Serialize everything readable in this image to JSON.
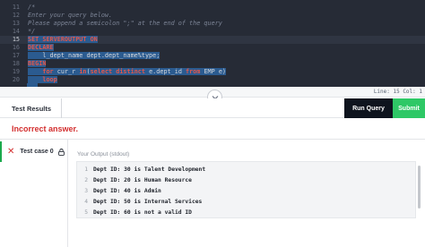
{
  "editor": {
    "lines": [
      {
        "num": "11",
        "parts": [
          {
            "t": "/*",
            "c": "cm"
          }
        ]
      },
      {
        "num": "12",
        "parts": [
          {
            "t": "Enter your query below.",
            "c": "cm"
          }
        ]
      },
      {
        "num": "13",
        "parts": [
          {
            "t": "Please append a semicolon \";\" at the end of the query",
            "c": "cm"
          }
        ]
      },
      {
        "num": "14",
        "parts": [
          {
            "t": "*/",
            "c": "cm"
          }
        ]
      },
      {
        "num": "15",
        "parts": [
          {
            "t": "SET SERVEROUTPUT ON",
            "c": "kw sel"
          }
        ],
        "active": true
      },
      {
        "num": "16",
        "parts": [
          {
            "t": "DECLARE",
            "c": "kw sel"
          }
        ]
      },
      {
        "num": "17",
        "parts": [
          {
            "t": "    l_dept_name dept.dept_name%type;",
            "c": "txt sel"
          }
        ]
      },
      {
        "num": "18",
        "parts": [
          {
            "t": "BEGIN",
            "c": "kw sel"
          }
        ]
      },
      {
        "num": "19",
        "parts": [
          {
            "t": "    for ",
            "c": "kw sel"
          },
          {
            "t": "cur_r ",
            "c": "txt sel"
          },
          {
            "t": "in",
            "c": "kw sel"
          },
          {
            "t": "(",
            "c": "txt sel"
          },
          {
            "t": "select distinct ",
            "c": "kw sel"
          },
          {
            "t": "e.dept_id ",
            "c": "txt sel"
          },
          {
            "t": "from ",
            "c": "kw sel"
          },
          {
            "t": "EMP e)",
            "c": "txt sel"
          }
        ]
      },
      {
        "num": "20",
        "parts": [
          {
            "t": "    loop",
            "c": "kw sel"
          }
        ]
      }
    ]
  },
  "statusbar": {
    "position": "Line: 15 Col: 1"
  },
  "toolbar": {
    "results_tab": "Test Results",
    "run_label": "Run Query",
    "submit_label": "Submit"
  },
  "result": {
    "message": "Incorrect answer."
  },
  "testcase": {
    "label": "Test case 0"
  },
  "output": {
    "label": "Your Output (stdout)",
    "lines": [
      {
        "num": "1",
        "text": "Dept ID: 30 is Talent Development"
      },
      {
        "num": "2",
        "text": "Dept ID: 20 is Human Resource"
      },
      {
        "num": "3",
        "text": "Dept ID: 40 is Admin"
      },
      {
        "num": "4",
        "text": "Dept ID: 50 is Internal Services"
      },
      {
        "num": "5",
        "text": "Dept ID: 60 is not a valid ID"
      }
    ]
  },
  "colors": {
    "run": "#0e141e",
    "submit": "#2ec866",
    "error": "#d32f2f",
    "selection": "#2b5b90"
  }
}
